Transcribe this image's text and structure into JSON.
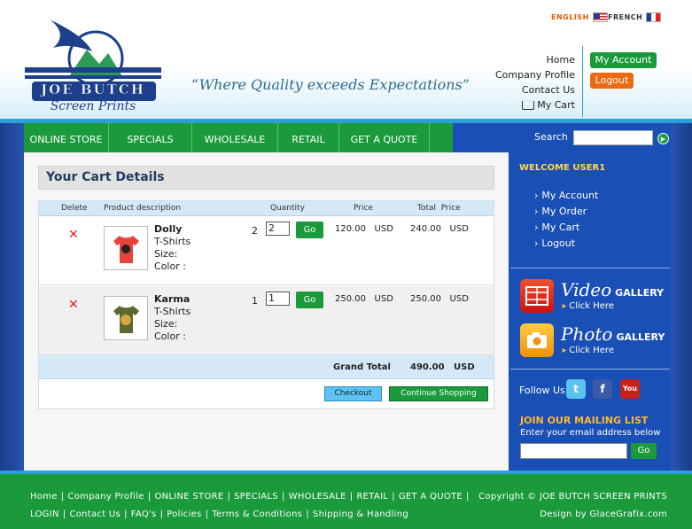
{
  "header": {
    "logo_text": "JOE BUTCH",
    "logo_sub": "Screen Prints",
    "tagline": "“Where Quality exceeds Expectations”",
    "lang_en": "ENGLISH",
    "lang_fr": "FRENCH",
    "links": [
      "Home",
      "Company Profile",
      "Contact Us",
      "My Cart"
    ],
    "my_account": "My Account",
    "logout": "Logout"
  },
  "nav": {
    "items": [
      "ONLINE STORE",
      "SPECIALS",
      "WHOLESALE",
      "RETAIL",
      "GET A QUOTE"
    ],
    "search_label": "Search"
  },
  "cart": {
    "title": "Your Cart Details",
    "headers": {
      "delete": "Delete",
      "product": "Product description",
      "quantity": "Quantity",
      "price": "Price",
      "total": "Total  Price"
    },
    "rows": [
      {
        "name": "Dolly",
        "type": "T-Shirts",
        "size": "Size:",
        "color": "Color :",
        "qty": "2",
        "qty_input": "2",
        "price": "120.00   USD",
        "total": "240.00   USD",
        "shirt_color": "#e8433a"
      },
      {
        "name": "Karma",
        "type": "T-Shirts",
        "size": "Size:",
        "color": "Color :",
        "qty": "1",
        "qty_input": "1",
        "price": "250.00   USD",
        "total": "250.00   USD",
        "shirt_color": "#5a6a2e"
      }
    ],
    "go": "Go",
    "grand_label": "Grand Total",
    "grand_value": "490.00   USD",
    "checkout": "Checkout",
    "continue": "Continue Shopping"
  },
  "sidebar": {
    "welcome": "WELCOME USER1",
    "links": [
      "My Account",
      "My Order",
      "My Cart",
      "Logout"
    ],
    "video_title": "Video",
    "photo_title": "Photo",
    "gallery_word": "GALLERY",
    "click_here": "Click Here",
    "follow_us": "Follow Us",
    "mailing_title": "JOIN OUR MAILING LIST",
    "mailing_sub": "Enter your email address below",
    "mailing_go": "Go"
  },
  "footer": {
    "row1": [
      "Home",
      "Company Profile",
      "ONLINE STORE",
      "SPECIALS",
      "WHOLESALE",
      "RETAIL",
      "GET A QUOTE"
    ],
    "row2": [
      "LOGIN",
      "Contact Us",
      "FAQ's",
      "Policies",
      "Terms & Conditions",
      "Shipping & Handling"
    ],
    "copyright": "Copyright © JOE BUTCH SCREEN PRINTS",
    "design": "Design by GlaceGrafix.com"
  }
}
